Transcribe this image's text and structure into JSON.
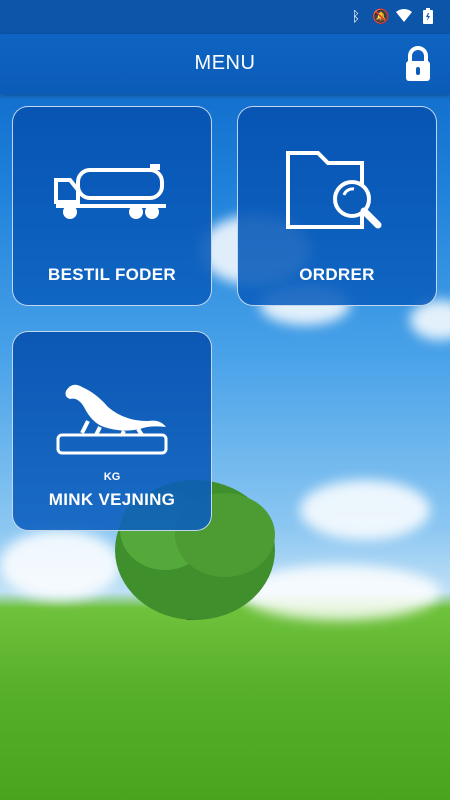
{
  "header": {
    "title": "MENU",
    "lock_icon": "lock-icon"
  },
  "status_bar": {
    "icons": [
      "bluetooth-icon",
      "mute-icon",
      "wifi-icon",
      "battery-icon"
    ]
  },
  "tiles": [
    {
      "label": "BESTIL FODER",
      "icon": "truck-icon"
    },
    {
      "label": "ORDRER",
      "icon": "folder-search-icon"
    },
    {
      "label": "MINK VEJNING",
      "icon": "mink-scale-icon",
      "badge": "KG"
    }
  ],
  "colors": {
    "accent": "#0b5cb8",
    "tile_bg": "#0752b0",
    "text": "#ffffff"
  }
}
